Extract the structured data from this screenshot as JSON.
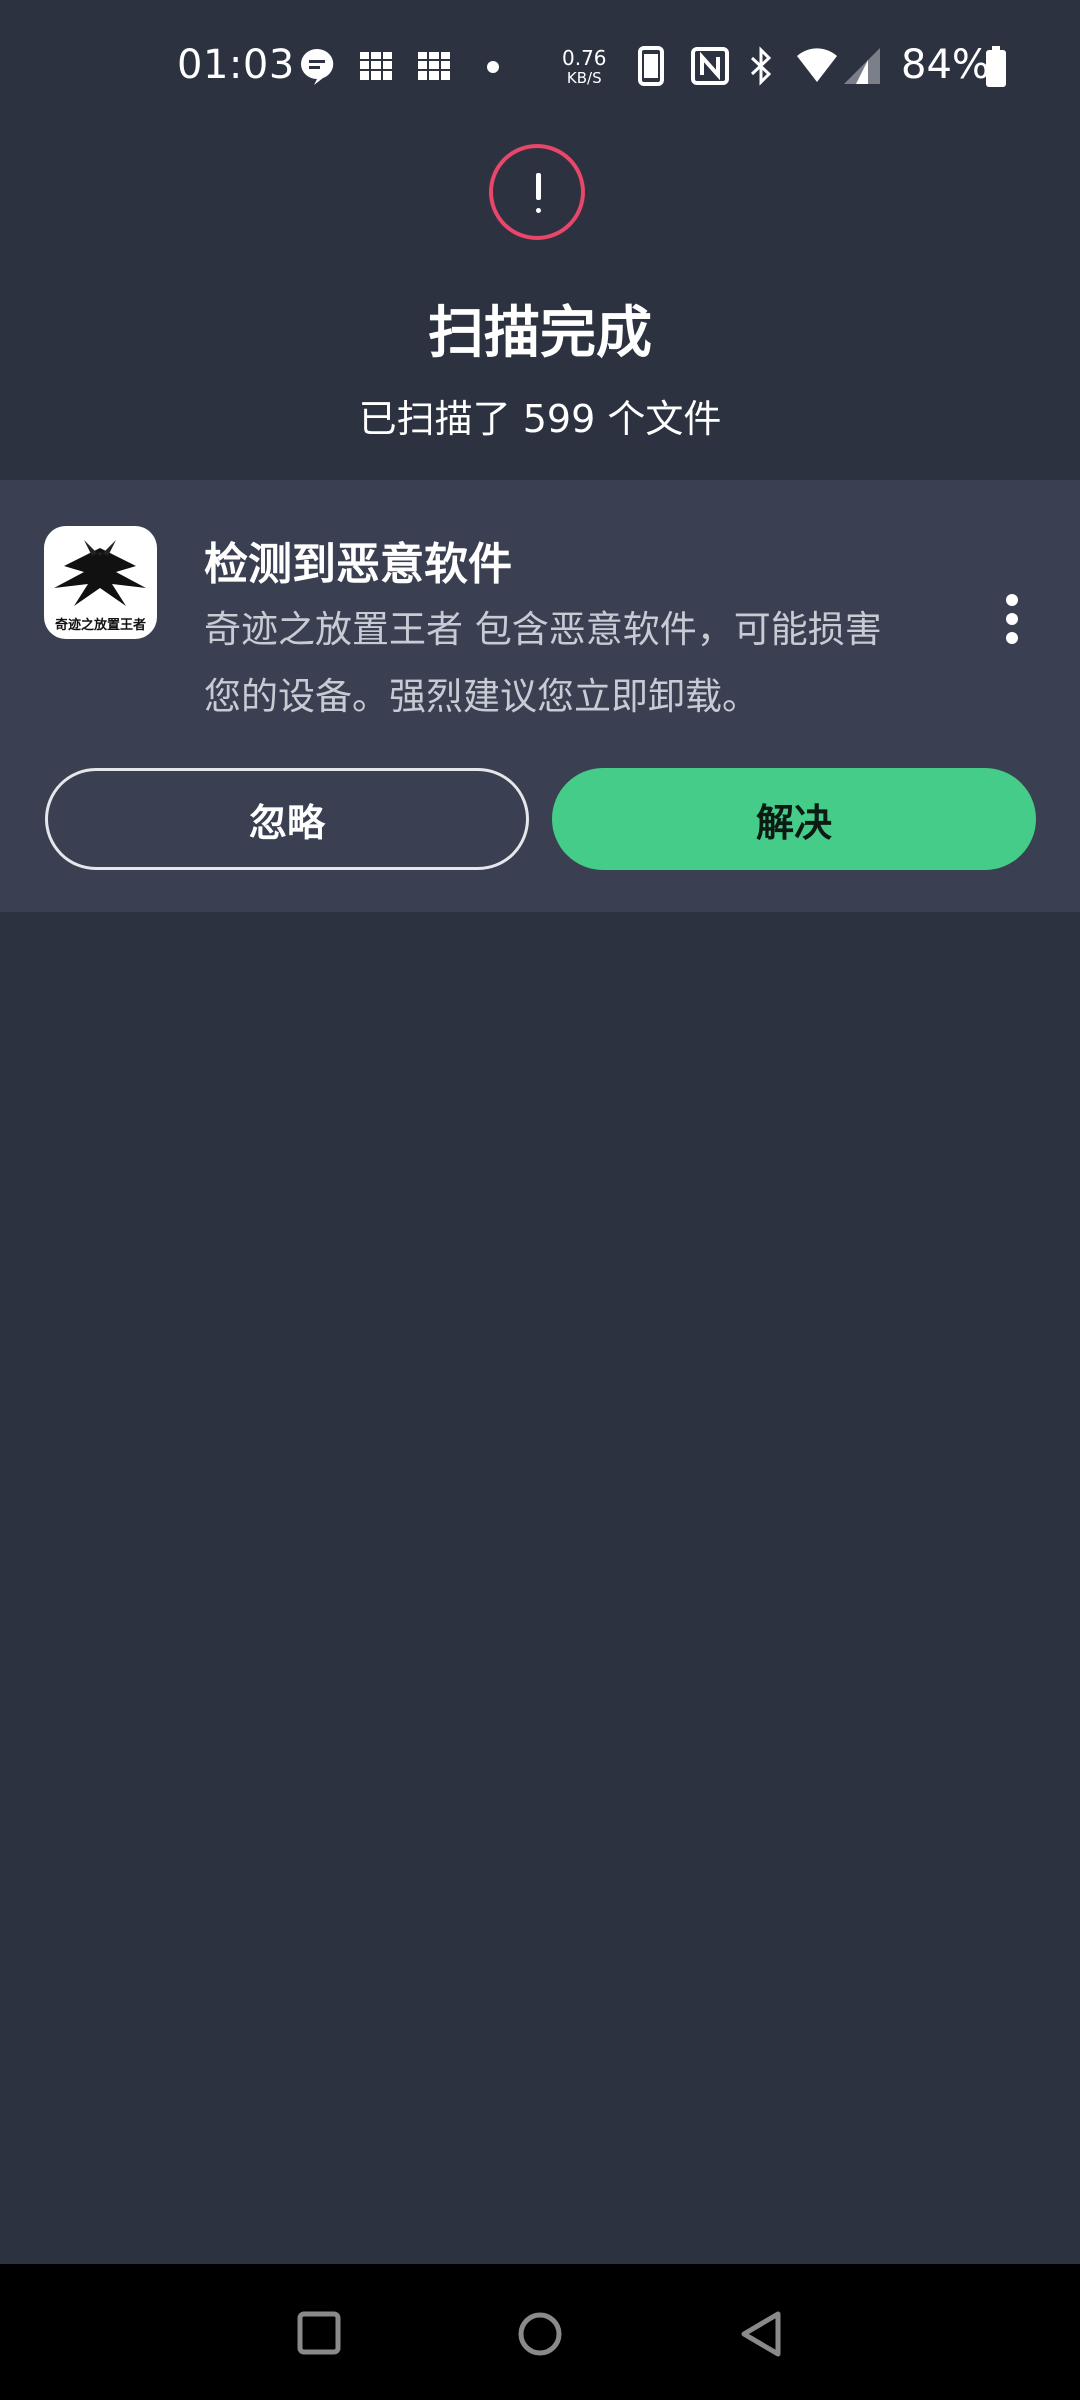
{
  "status_bar": {
    "time": "01:03",
    "net_speed_value": "0.76",
    "net_speed_unit": "KB/S",
    "battery_percent": "84%",
    "icons": [
      "message-icon",
      "notification-icon",
      "notification-icon",
      "dot-icon",
      "phone-icon",
      "nfc-icon",
      "bluetooth-icon",
      "wifi-icon",
      "signal-icon",
      "battery-icon"
    ]
  },
  "header": {
    "status_icon": "alert-icon",
    "alert_color": "#e8466a",
    "title": "扫描完成",
    "subtitle": "已扫描了 599 个文件"
  },
  "threat_card": {
    "app_icon_caption": "奇迹之放置王者",
    "title": "检测到恶意软件",
    "description": "奇迹之放置王者 包含恶意软件，可能损害您的设备。强烈建议您立即卸载。",
    "menu_icon": "more-vert-icon",
    "ignore_label": "忽略",
    "resolve_label": "解决",
    "resolve_color": "#44cc88"
  },
  "nav_bar": {
    "items": [
      "recents-icon",
      "home-icon",
      "back-icon"
    ]
  }
}
